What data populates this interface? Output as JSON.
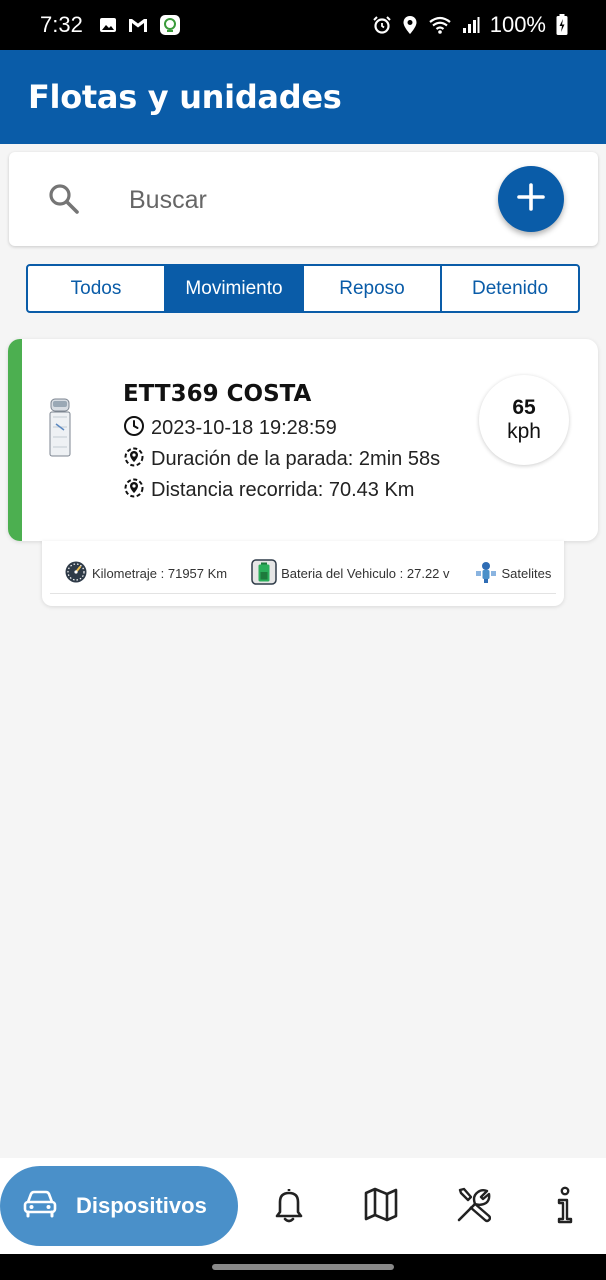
{
  "status_bar": {
    "time": "7:32",
    "battery_text": "100%",
    "left_icons": [
      "image-icon",
      "gmail-icon",
      "app-icon"
    ],
    "right_icons": [
      "alarm-icon",
      "location-icon",
      "wifi-icon",
      "signal-icon",
      "battery-icon"
    ]
  },
  "app_bar": {
    "title": "Flotas y unidades"
  },
  "search": {
    "placeholder": "Buscar",
    "value": "",
    "icon": "search-icon",
    "add_icon": "plus-icon"
  },
  "filter_tabs": [
    {
      "label": "Todos",
      "active": false
    },
    {
      "label": "Movimiento",
      "active": true
    },
    {
      "label": "Reposo",
      "active": false
    },
    {
      "label": "Detenido",
      "active": false
    }
  ],
  "device": {
    "name": "ETT369 COSTA",
    "timestamp": "2023-10-18 19:28:59",
    "stop_duration": "Duración de la parada: 2min 58s",
    "distance": "Distancia recorrida: 70.43 Km",
    "speed_value": "65",
    "speed_unit": "kph",
    "status_color": "#4caf50",
    "details": [
      {
        "icon": "odometer-icon",
        "label": "Kilometraje : 71957 Km"
      },
      {
        "icon": "vehicle-battery-icon",
        "label": "Bateria del Vehiculo : 27.22 v"
      },
      {
        "icon": "satellite-icon",
        "label": "Satelites"
      }
    ]
  },
  "bottom_nav": {
    "active_label": "Dispositivos",
    "items": [
      "car-icon",
      "bell-icon",
      "map-icon",
      "tools-icon",
      "info-icon"
    ]
  },
  "colors": {
    "primary": "#0a5ca8",
    "nav_active": "#4a90c9",
    "status_moving": "#4caf50"
  }
}
